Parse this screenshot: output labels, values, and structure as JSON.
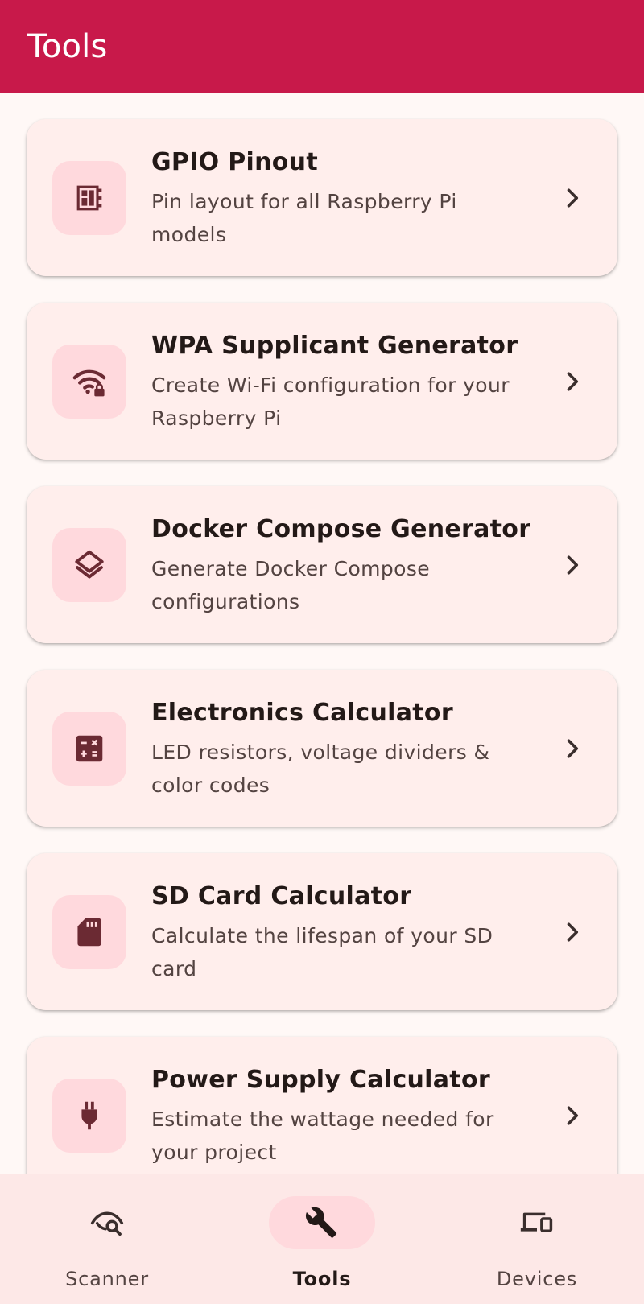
{
  "app_bar": {
    "title": "Tools"
  },
  "tools": [
    {
      "title": "GPIO Pinout",
      "subtitle": "Pin layout for all Raspberry Pi models",
      "icon": "chip-icon"
    },
    {
      "title": "WPA Supplicant Generator",
      "subtitle": "Create Wi-Fi configuration for your Raspberry Pi",
      "icon": "wifi-lock-icon"
    },
    {
      "title": "Docker Compose Generator",
      "subtitle": "Generate Docker Compose configurations",
      "icon": "layers-icon"
    },
    {
      "title": "Electronics Calculator",
      "subtitle": "LED resistors, voltage dividers & color codes",
      "icon": "calculator-icon"
    },
    {
      "title": "SD Card Calculator",
      "subtitle": "Calculate the lifespan of your SD card",
      "icon": "sd-card-icon"
    },
    {
      "title": "Power Supply Calculator",
      "subtitle": "Estimate the wattage needed for your project",
      "icon": "power-plug-icon"
    }
  ],
  "bottom_nav": {
    "items": [
      {
        "label": "Scanner",
        "icon": "eye-search-icon",
        "active": false
      },
      {
        "label": "Tools",
        "icon": "wrench-icon",
        "active": true
      },
      {
        "label": "Devices",
        "icon": "devices-icon",
        "active": false
      }
    ]
  },
  "colors": {
    "app_bar": "#C8194A",
    "background": "#FFF8F6",
    "card": "#FFEEEC",
    "icon_container": "#FFD9DD",
    "icon": "#6B2A33",
    "nav_background": "#FDE8E7"
  }
}
